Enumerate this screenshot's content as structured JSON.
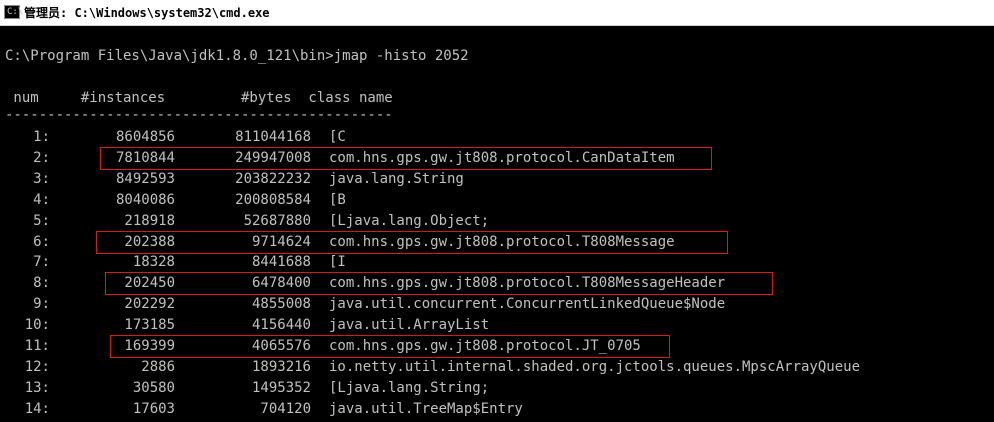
{
  "window": {
    "title": "管理员: C:\\Windows\\system32\\cmd.exe",
    "icon_label": "C:\\"
  },
  "console": {
    "command": "C:\\Program Files\\Java\\jdk1.8.0_121\\bin>jmap -histo 2052",
    "header": " num     #instances         #bytes  class name",
    "separator": "----------------------------------------------",
    "rows": [
      {
        "num": "1:",
        "instances": "8604856",
        "bytes": "811044168",
        "class": "[C"
      },
      {
        "num": "2:",
        "instances": "7810844",
        "bytes": "249947008",
        "class": "com.hns.gps.gw.jt808.protocol.CanDataItem",
        "highlighted": true
      },
      {
        "num": "3:",
        "instances": "8492593",
        "bytes": "203822232",
        "class": "java.lang.String"
      },
      {
        "num": "4:",
        "instances": "8040086",
        "bytes": "200808584",
        "class": "[B"
      },
      {
        "num": "5:",
        "instances": "218918",
        "bytes": "52687880",
        "class": "[Ljava.lang.Object;"
      },
      {
        "num": "6:",
        "instances": "202388",
        "bytes": "9714624",
        "class": "com.hns.gps.gw.jt808.protocol.T808Message",
        "highlighted": true
      },
      {
        "num": "7:",
        "instances": "18328",
        "bytes": "8441688",
        "class": "[I"
      },
      {
        "num": "8:",
        "instances": "202450",
        "bytes": "6478400",
        "class": "com.hns.gps.gw.jt808.protocol.T808MessageHeader",
        "highlighted": true
      },
      {
        "num": "9:",
        "instances": "202292",
        "bytes": "4855008",
        "class": "java.util.concurrent.ConcurrentLinkedQueue$Node"
      },
      {
        "num": "10:",
        "instances": "173185",
        "bytes": "4156440",
        "class": "java.util.ArrayList"
      },
      {
        "num": "11:",
        "instances": "169399",
        "bytes": "4065576",
        "class": "com.hns.gps.gw.jt808.protocol.JT_0705",
        "highlighted": true
      },
      {
        "num": "12:",
        "instances": "2886",
        "bytes": "1893216",
        "class": "io.netty.util.internal.shaded.org.jctools.queues.MpscArrayQueue"
      },
      {
        "num": "13:",
        "instances": "30580",
        "bytes": "1495352",
        "class": "[Ljava.lang.String;"
      },
      {
        "num": "14:",
        "instances": "17603",
        "bytes": "704120",
        "class": "java.util.TreeMap$Entry"
      }
    ]
  },
  "colors": {
    "console_bg": "#000000",
    "console_text": "#c0c0c0",
    "highlight_box": "#d21c1c"
  }
}
